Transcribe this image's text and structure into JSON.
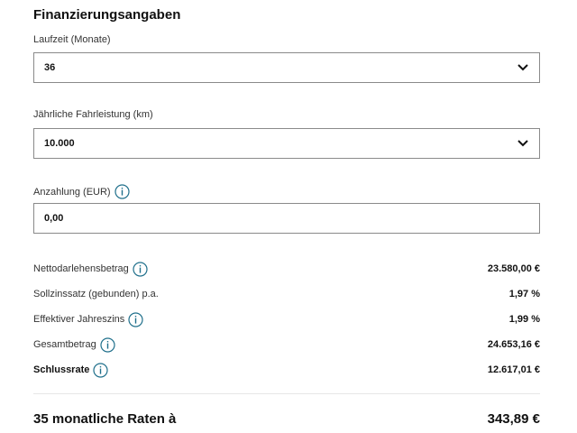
{
  "title": "Finanzierungsangaben",
  "fields": {
    "laufzeit": {
      "label": "Laufzeit (Monate)",
      "value": "36"
    },
    "fahrleistung": {
      "label": "Jährliche Fahrleistung (km)",
      "value": "10.000"
    },
    "anzahlung": {
      "label": "Anzahlung (EUR)",
      "value": "0,00"
    }
  },
  "summary": [
    {
      "label": "Nettodarlehensbetrag",
      "value": "23.580,00 €",
      "info": true
    },
    {
      "label": "Sollzinssatz (gebunden) p.a.",
      "value": "1,97 %",
      "info": false
    },
    {
      "label": "Effektiver Jahreszins",
      "value": "1,99 %",
      "info": true
    },
    {
      "label": "Gesamtbetrag",
      "value": "24.653,16 €",
      "info": true
    },
    {
      "label": "Schlussrate",
      "value": "12.617,01 €",
      "info": true
    }
  ],
  "total": {
    "label": "35 monatliche Raten à",
    "value": "343,89 €"
  },
  "icons": {
    "dropdown": "chevron-down-icon",
    "info": "info-icon"
  },
  "colors": {
    "info_icon": "#1f6f8b",
    "border": "#8a8a8a",
    "text": "#111111"
  }
}
